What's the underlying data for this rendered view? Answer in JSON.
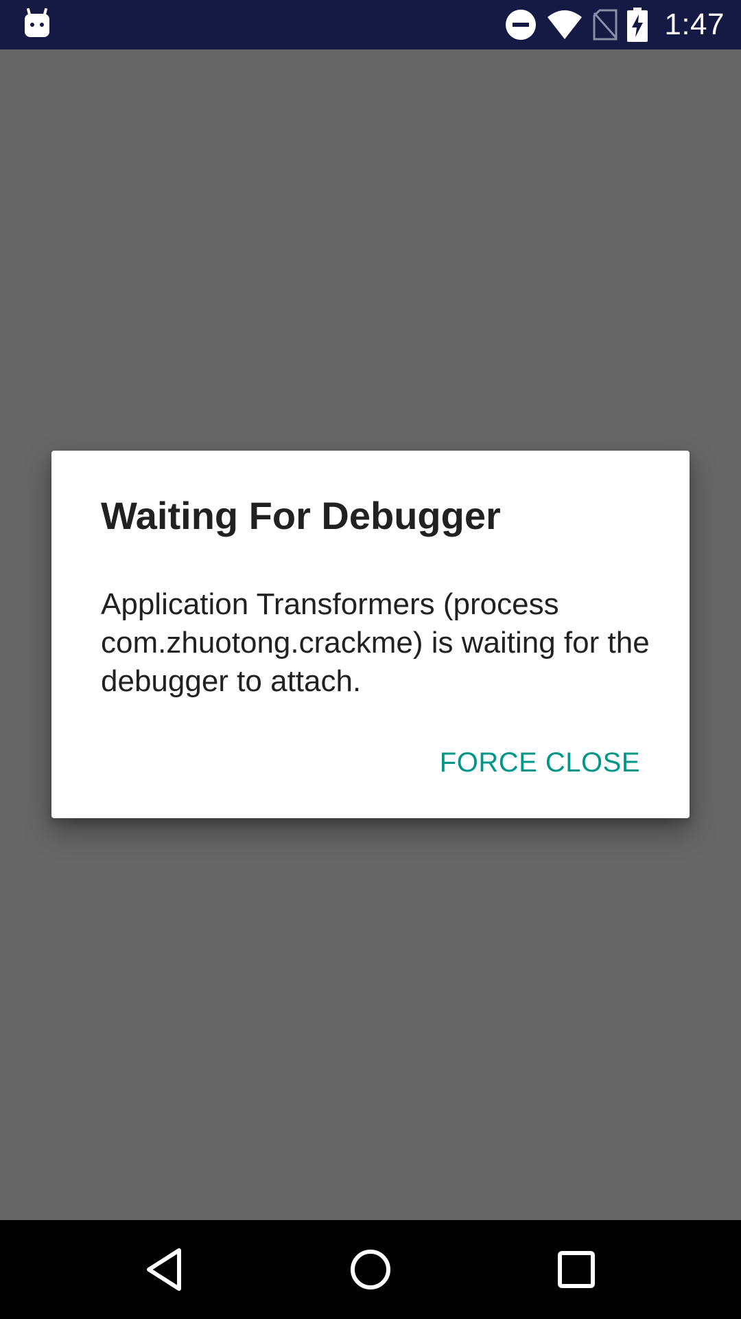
{
  "status_bar": {
    "time": "1:47",
    "icons": [
      "android-debug-icon",
      "do-not-disturb-icon",
      "wifi-icon",
      "no-sim-icon",
      "battery-charging-icon"
    ]
  },
  "dialog": {
    "title": "Waiting For Debugger",
    "message": "Application Transformers (process com.zhuotong.crackme) is waiting for the debugger to attach.",
    "action_label": "FORCE CLOSE",
    "accent_color": "#009688"
  },
  "nav_bar": {
    "icons": [
      "back-icon",
      "home-icon",
      "recents-icon"
    ]
  },
  "colors": {
    "status_bar": "#151a45",
    "scrim": "#666666",
    "nav_bar": "#000000"
  }
}
